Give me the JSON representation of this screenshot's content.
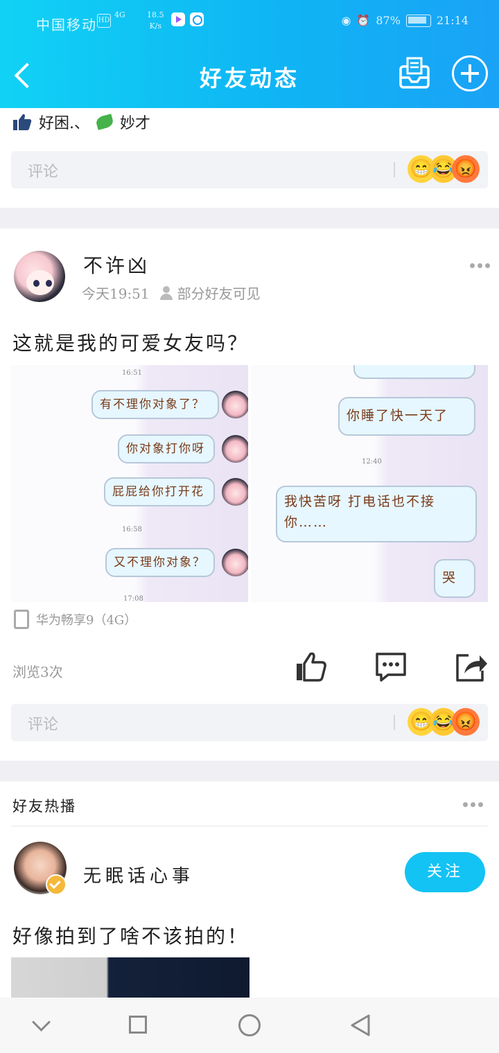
{
  "status_bar": {
    "carrier": "中国移动",
    "hd": "HD",
    "network": "4G",
    "speed_value": "18.5",
    "speed_unit": "K/s",
    "battery": "87%",
    "time": "21:14"
  },
  "header": {
    "title": "好友动态"
  },
  "post0": {
    "likers": "好困.、",
    "likers2": "妙才",
    "comment_placeholder": "评论"
  },
  "post1": {
    "username": "不许凶",
    "time": "今天19:51",
    "visibility": "部分好友可见",
    "text": "这就是我的可爱女友吗？",
    "image_left": {
      "time_top": "16:51",
      "bubbles": [
        "有不理你对象了？",
        "你对象打你呀",
        "屁屁给你打开花",
        "又不理你对象？"
      ],
      "time_mid": "16:58",
      "time_bottom": "17:08"
    },
    "image_right": {
      "bubbles": [
        "你睡了快一天了",
        "我快苦呀 打电话也不接你……",
        "哭"
      ],
      "time_mid": "12:40"
    },
    "device": "华为畅享9（4G）",
    "views": "浏览3次",
    "comment_placeholder": "评论"
  },
  "hot_section": {
    "title": "好友热播",
    "username": "无眠话心事",
    "follow_label": "关注",
    "post_text": "好像拍到了啥不该拍的！"
  },
  "icons": {
    "back": "back-arrow-icon",
    "inbox": "inbox-icon",
    "add": "plus-circle-icon",
    "like": "thumbs-up-icon",
    "comment": "comment-bubble-icon",
    "share": "share-icon"
  }
}
